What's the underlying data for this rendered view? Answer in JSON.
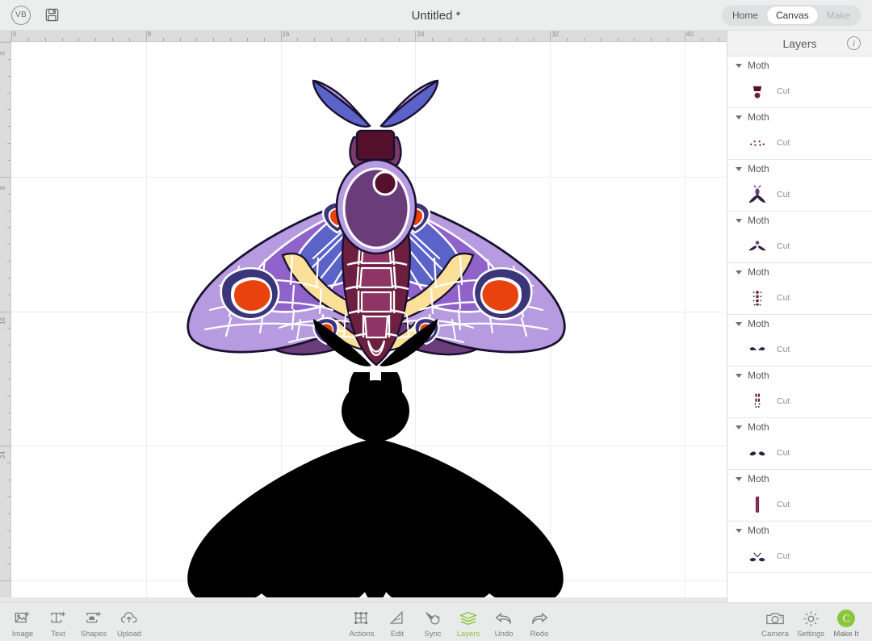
{
  "app": {
    "user_initials": "VB",
    "document_title": "Untitled *",
    "save_icon": "floppy-disk-icon"
  },
  "modes": [
    {
      "label": "Home",
      "state": "normal"
    },
    {
      "label": "Canvas",
      "state": "active"
    },
    {
      "label": "Make",
      "state": "disabled"
    }
  ],
  "ruler": {
    "horizontal_labels": [
      "0",
      "8",
      "16",
      "24",
      "32",
      "40"
    ],
    "vertical_labels": [
      "0",
      "8",
      "16",
      "24"
    ],
    "unit_step": 8
  },
  "layers_panel": {
    "title": "Layers",
    "info_icon": "info-icon",
    "groups": [
      {
        "name": "Moth",
        "operation": "Cut",
        "thumb": "head-plate-and-dot"
      },
      {
        "name": "Moth",
        "operation": "Cut",
        "thumb": "scatter-dots"
      },
      {
        "name": "Moth",
        "operation": "Cut",
        "thumb": "body-with-wings"
      },
      {
        "name": "Moth",
        "operation": "Cut",
        "thumb": "lower-wing-pair"
      },
      {
        "name": "Moth",
        "operation": "Cut",
        "thumb": "segmented-abdomen"
      },
      {
        "name": "Moth",
        "operation": "Cut",
        "thumb": "eyespot-pair"
      },
      {
        "name": "Moth",
        "operation": "Cut",
        "thumb": "abdomen-spots"
      },
      {
        "name": "Moth",
        "operation": "Cut",
        "thumb": "antenna-pair"
      },
      {
        "name": "Moth",
        "operation": "Cut",
        "thumb": "thorax-stripe"
      },
      {
        "name": "Moth",
        "operation": "Cut",
        "thumb": "antennae-dark"
      }
    ]
  },
  "toolbar_left": [
    {
      "label": "Image",
      "icon": "add-image-icon"
    },
    {
      "label": "Text",
      "icon": "add-text-icon"
    },
    {
      "label": "Shapes",
      "icon": "add-shapes-icon"
    },
    {
      "label": "Upload",
      "icon": "upload-cloud-icon"
    }
  ],
  "toolbar_center": [
    {
      "label": "Actions",
      "icon": "actions-icon",
      "state": "normal"
    },
    {
      "label": "Edit",
      "icon": "edit-ruler-icon",
      "state": "normal"
    },
    {
      "label": "Sync",
      "icon": "sync-paint-icon",
      "state": "normal"
    },
    {
      "label": "Layers",
      "icon": "layers-stack-icon",
      "state": "active"
    },
    {
      "label": "Undo",
      "icon": "undo-arrow-icon",
      "state": "normal"
    },
    {
      "label": "Redo",
      "icon": "redo-arrow-icon",
      "state": "normal"
    }
  ],
  "toolbar_right": [
    {
      "label": "Camera",
      "icon": "camera-icon"
    },
    {
      "label": "Settings",
      "icon": "gear-icon"
    },
    {
      "label": "Make It",
      "icon": "make-it-logo"
    }
  ],
  "colors": {
    "accent_green": "#8cc63e",
    "canvas_bg": "#ffffff",
    "chrome_bg": "#e9eaea",
    "ruler_bg": "#dcdcdc",
    "grid_line": "#ededed",
    "moth_wing_blue": "#5b63c8",
    "moth_wing_light_purple": "#b79be0",
    "moth_wing_purple": "#8f63c9",
    "moth_eyespot_orange": "#e8430f",
    "moth_eyespot_ring": "#3b3579",
    "moth_band_yellow": "#fbe09a",
    "moth_body_maroon": "#6d1f3f",
    "moth_body_plum": "#8f3566",
    "moth_head_purple": "#6b3c7a",
    "silhouette_black": "#000000",
    "outline_white": "#ffffff",
    "outline_dark": "#1a1030"
  },
  "artwork": {
    "top_figure": "colored-stained-glass-moth",
    "bottom_figure": "black-silhouette-moth"
  }
}
